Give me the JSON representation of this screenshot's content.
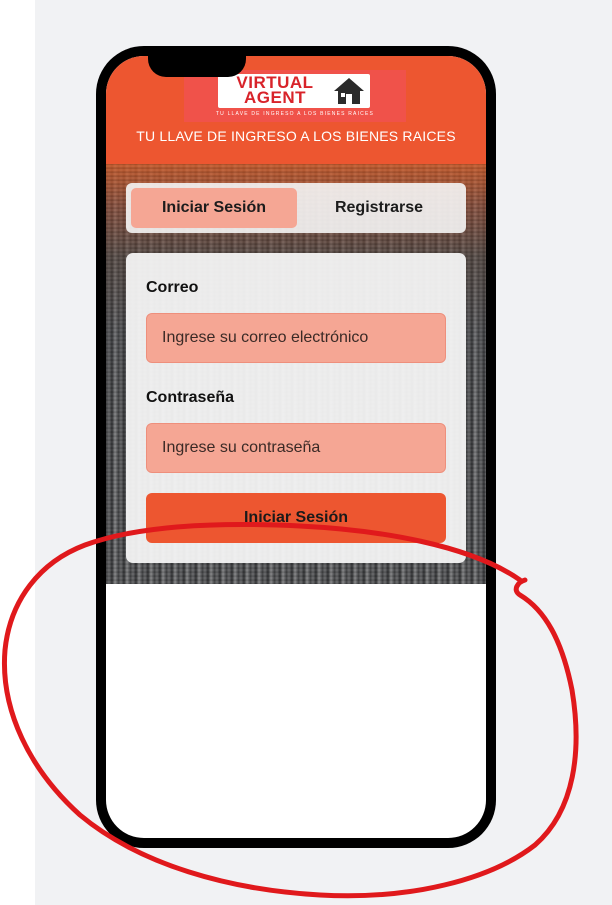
{
  "brand": {
    "logo_line1": "VIRTUAL",
    "logo_line2": "AGENT",
    "logo_tagline": "TU LLAVE DE INGRESO A LOS BIENES RAICES",
    "header_title": "TU LLAVE DE INGRESO A LOS BIENES RAICES",
    "color_primary": "#ed5630",
    "color_logo": "#d8232a"
  },
  "tabs": [
    {
      "label": "Iniciar Sesión",
      "active": true
    },
    {
      "label": "Registrarse",
      "active": false
    }
  ],
  "form": {
    "email": {
      "label": "Correo",
      "placeholder": "Ingrese su correo electrónico",
      "value": ""
    },
    "password": {
      "label": "Contraseña",
      "placeholder": "Ingrese su contraseña",
      "value": ""
    },
    "submit_label": "Iniciar Sesión",
    "input_fill_color": "#f5a694"
  },
  "annotation": {
    "shape": "freehand-ellipse",
    "color": "#e0191c"
  }
}
